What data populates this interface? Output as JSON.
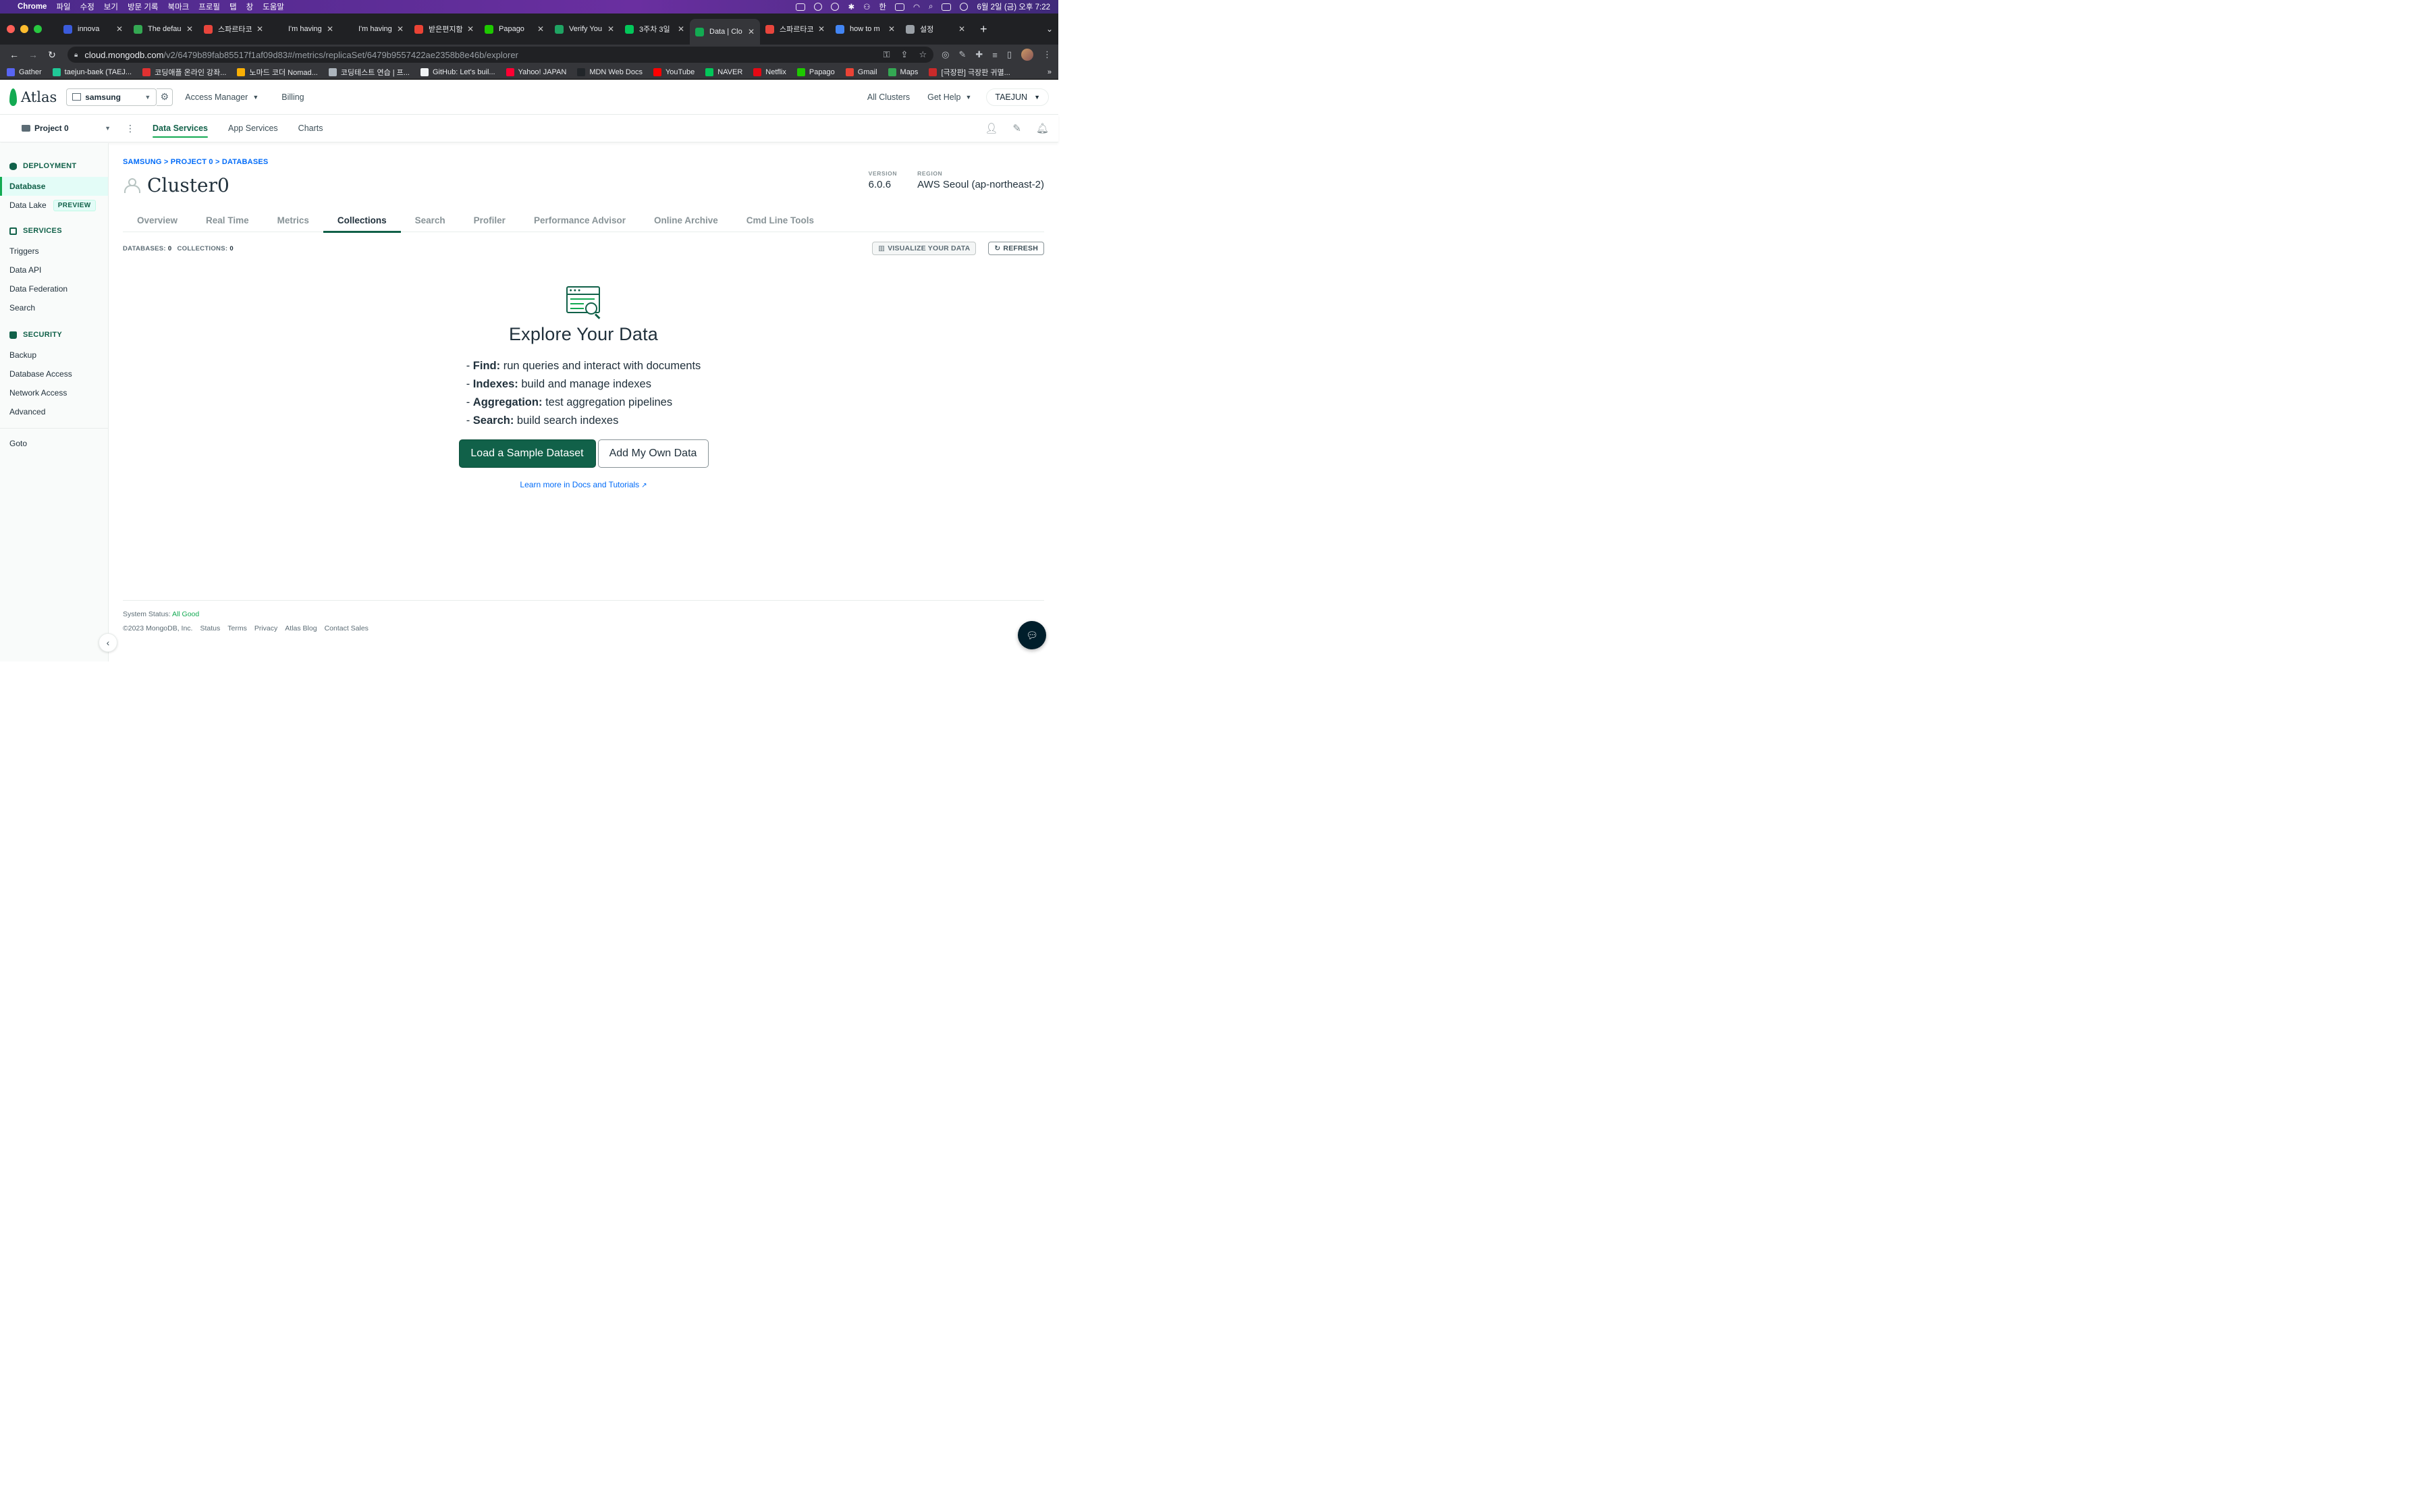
{
  "mac_menubar": {
    "app": "Chrome",
    "menus": [
      "파일",
      "수정",
      "보기",
      "방문 기록",
      "북마크",
      "프로필",
      "탭",
      "창",
      "도움말"
    ],
    "clock": "6월 2일 (금) 오후 7:22",
    "input_method": "한"
  },
  "browser": {
    "tabs": [
      {
        "title": "innova",
        "color": "#3b5bdb"
      },
      {
        "title": "The defau",
        "color": "#34a853"
      },
      {
        "title": "스파르타코",
        "color": "#e8453c"
      },
      {
        "title": "I'm having",
        "color": "#202124"
      },
      {
        "title": "I'm having",
        "color": "#202124"
      },
      {
        "title": "받은편지함",
        "color": "#ea4335"
      },
      {
        "title": "Papago",
        "color": "#1ec800"
      },
      {
        "title": "Verify You",
        "color": "#1fa463"
      },
      {
        "title": "3주차 3일",
        "color": "#03c75a"
      },
      {
        "title": "Data | Clo",
        "color": "#13aa52"
      },
      {
        "title": "스파르타코",
        "color": "#e8453c"
      },
      {
        "title": "how to m",
        "color": "#4285f4"
      },
      {
        "title": "설정",
        "color": "#9aa0a6"
      }
    ],
    "active_tab_index": 9,
    "url_host": "cloud.mongodb.com",
    "url_path": "/v2/6479b89fab85517f1af09d83#/metrics/replicaSet/6479b9557422ae2358b8e46b/explorer",
    "bookmarks": [
      {
        "label": "Gather",
        "color": "#5865f2"
      },
      {
        "label": "taejun-baek (TAEJ...",
        "color": "#20c997"
      },
      {
        "label": "코딩애플 온라인 강좌...",
        "color": "#e03131"
      },
      {
        "label": "노마드 코더 Nomad...",
        "color": "#fab005"
      },
      {
        "label": "코딩테스트 연습 | 프...",
        "color": "#adb5bd"
      },
      {
        "label": "GitHub: Let's buil...",
        "color": "#f1f3f5"
      },
      {
        "label": "Yahoo! JAPAN",
        "color": "#ff0033"
      },
      {
        "label": "MDN Web Docs",
        "color": "#212529"
      },
      {
        "label": "YouTube",
        "color": "#ff0000"
      },
      {
        "label": "NAVER",
        "color": "#03c75a"
      },
      {
        "label": "Netflix",
        "color": "#e50914"
      },
      {
        "label": "Papago",
        "color": "#1ec800"
      },
      {
        "label": "Gmail",
        "color": "#ea4335"
      },
      {
        "label": "Maps",
        "color": "#34a853"
      },
      {
        "label": "[극장판] 극장판 귀멸...",
        "color": "#c92a2a"
      }
    ],
    "bookmarks_more": "»"
  },
  "atlas": {
    "logo": "Atlas",
    "org": "samsung",
    "top_nav": {
      "access_manager": "Access Manager",
      "billing": "Billing"
    },
    "top_right": {
      "all_clusters": "All Clusters",
      "get_help": "Get Help",
      "user": "TAEJUN"
    },
    "project": "Project 0",
    "project_tabs": {
      "data_services": "Data Services",
      "app_services": "App Services",
      "charts": "Charts"
    }
  },
  "sidebar": {
    "deployment": "DEPLOYMENT",
    "database": "Database",
    "data_lake": "Data Lake",
    "preview": "PREVIEW",
    "services": "SERVICES",
    "triggers": "Triggers",
    "data_api": "Data API",
    "data_federation": "Data Federation",
    "search": "Search",
    "security": "SECURITY",
    "backup": "Backup",
    "database_access": "Database Access",
    "network_access": "Network Access",
    "advanced": "Advanced",
    "goto": "Goto"
  },
  "main": {
    "breadcrumb": "SAMSUNG > PROJECT 0 > DATABASES",
    "cluster_name": "Cluster0",
    "version_label": "VERSION",
    "version": "6.0.6",
    "region_label": "REGION",
    "region": "AWS Seoul (ap-northeast-2)",
    "tabs": [
      "Overview",
      "Real Time",
      "Metrics",
      "Collections",
      "Search",
      "Profiler",
      "Performance Advisor",
      "Online Archive",
      "Cmd Line Tools"
    ],
    "active_tab": "Collections",
    "databases_label": "DATABASES:",
    "databases_count": "0",
    "collections_label": "COLLECTIONS:",
    "collections_count": "0",
    "visualize_btn": "VISUALIZE YOUR DATA",
    "refresh_btn": "REFRESH",
    "explore_title": "Explore Your Data",
    "features": [
      {
        "key": "Find:",
        "text": "run queries and interact with documents"
      },
      {
        "key": "Indexes:",
        "text": "build and manage indexes"
      },
      {
        "key": "Aggregation:",
        "text": "test aggregation pipelines"
      },
      {
        "key": "Search:",
        "text": "build search indexes"
      }
    ],
    "load_sample": "Load a Sample Dataset",
    "add_own": "Add My Own Data",
    "docs_link": "Learn more in Docs and Tutorials"
  },
  "footer": {
    "status_label": "System Status:",
    "status_value": "All Good",
    "copyright": "©2023 MongoDB, Inc.",
    "links": [
      "Status",
      "Terms",
      "Privacy",
      "Atlas Blog",
      "Contact Sales"
    ]
  }
}
